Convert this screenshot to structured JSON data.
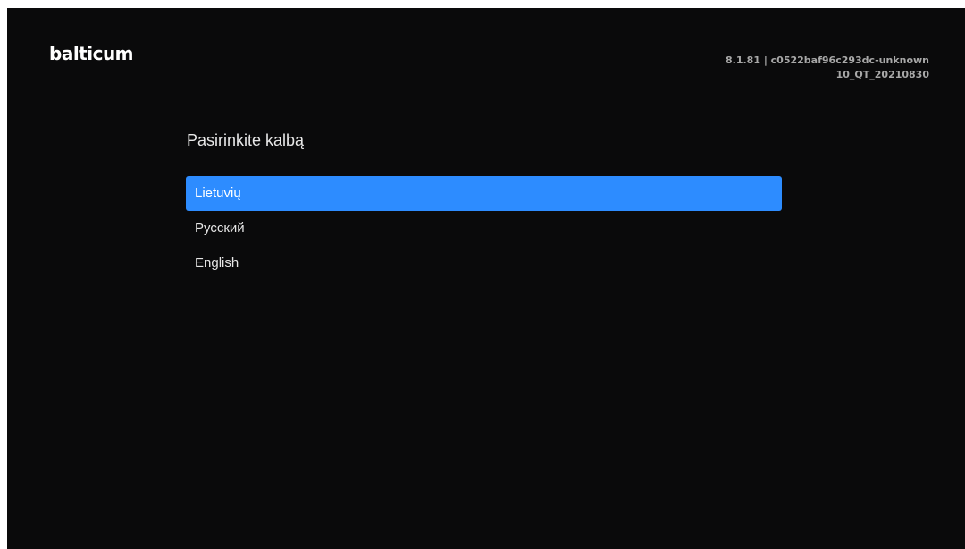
{
  "brand": {
    "logo_text": "balticum"
  },
  "version": {
    "line1": "8.1.81 | c0522baf96c293dc-unknown",
    "line2": "10_QT_20210830"
  },
  "language_select": {
    "title": "Pasirinkite kalbą",
    "options": [
      {
        "label": "Lietuvių",
        "selected": true
      },
      {
        "label": "Русский",
        "selected": false
      },
      {
        "label": "English",
        "selected": false
      }
    ]
  },
  "colors": {
    "background": "#0a0a0b",
    "selection": "#2d8cff",
    "text": "#e6e6e6",
    "version_text": "#a8a8a8"
  }
}
